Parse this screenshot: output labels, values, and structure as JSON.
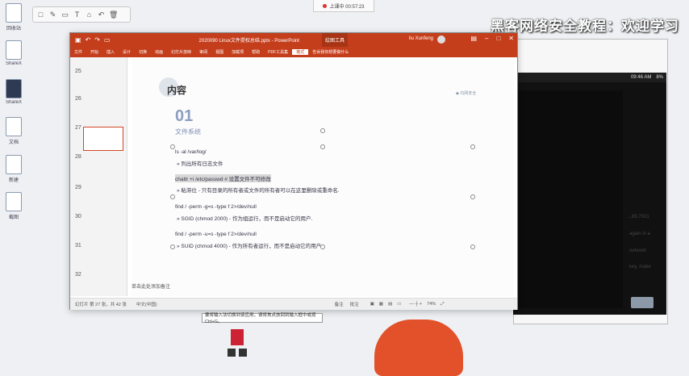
{
  "colors": {
    "accent": "#c43e1c",
    "slide_blue": "#8b9ec2",
    "desktop": "#eef0f3"
  },
  "desktop": {
    "icons": [
      {
        "label": "回收站",
        "icon": "recycle-bin-icon"
      },
      {
        "label": "ShareX",
        "icon": "app-icon"
      },
      {
        "label": "ShareX",
        "icon": "app-icon"
      },
      {
        "label": "文档",
        "icon": "document-icon"
      },
      {
        "label": "新建",
        "icon": "document-icon"
      },
      {
        "label": "截图",
        "icon": "app-icon"
      }
    ]
  },
  "annotation_toolbar": {
    "tools": [
      "□",
      "✎",
      "▭",
      "T",
      "⌂",
      "↶",
      "🗑"
    ]
  },
  "recorder": {
    "label": "上课中 00:57:23"
  },
  "watermark": "黑客网络安全教程：欢迎学习",
  "vm": {
    "time": "09:46 AM",
    "battery": "8%"
  },
  "background_window": {
    "lines": [
      "...89.7001",
      "again in a",
      "network",
      "key, make"
    ],
    "link": "Refresh"
  },
  "ppt": {
    "title": "2020090 Linux文件提权总结.pptx - PowerPoint",
    "context_tab": "绘图工具",
    "user": "liu Xunfeng",
    "ribbon_tabs": [
      "文件",
      "开始",
      "插入",
      "设计",
      "切换",
      "动画",
      "幻灯片放映",
      "审阅",
      "视图",
      "加载项",
      "帮助",
      "PDF工具集",
      "格式",
      "告诉我你想要做什么"
    ],
    "selected_tab": "格式",
    "thumb_numbers": [
      "25",
      "26",
      "27",
      "28",
      "29",
      "30",
      "31",
      "32"
    ],
    "notes_placeholder": "单击此处添加备注",
    "status": {
      "slide": "幻灯片 第 27 张，共 42 张",
      "lang": "中文(中国)",
      "notes": "备注",
      "comments": "批注",
      "zoom": "74%"
    },
    "slide": {
      "heading": "内容",
      "number": "01",
      "subtitle": "文件系统",
      "logo": "◆ 内网安全",
      "lines": [
        "ls -al /var/log/",
        "» 列出所有日志文件",
        "chattr +i /etc/passwd  # 设置文件不可修改",
        "» 粘滞位 - 只有目录的所有者或文件的所有者可以在这里删除或重命名.",
        "find / -perm -g=s -type f 2>/dev/null",
        "» SGID (chmod 2000) - 作为组运行，而不是启动它的用户.",
        "find / -perm -u=s -type f 2>/dev/null",
        "» SUID (chmod 4000) - 作为所有者运行，而不是启动它的用户."
      ]
    }
  },
  "tooltip": "要将输入法切换到该应用，请将焦点放回到输入框中或按 Ctrl+G。"
}
